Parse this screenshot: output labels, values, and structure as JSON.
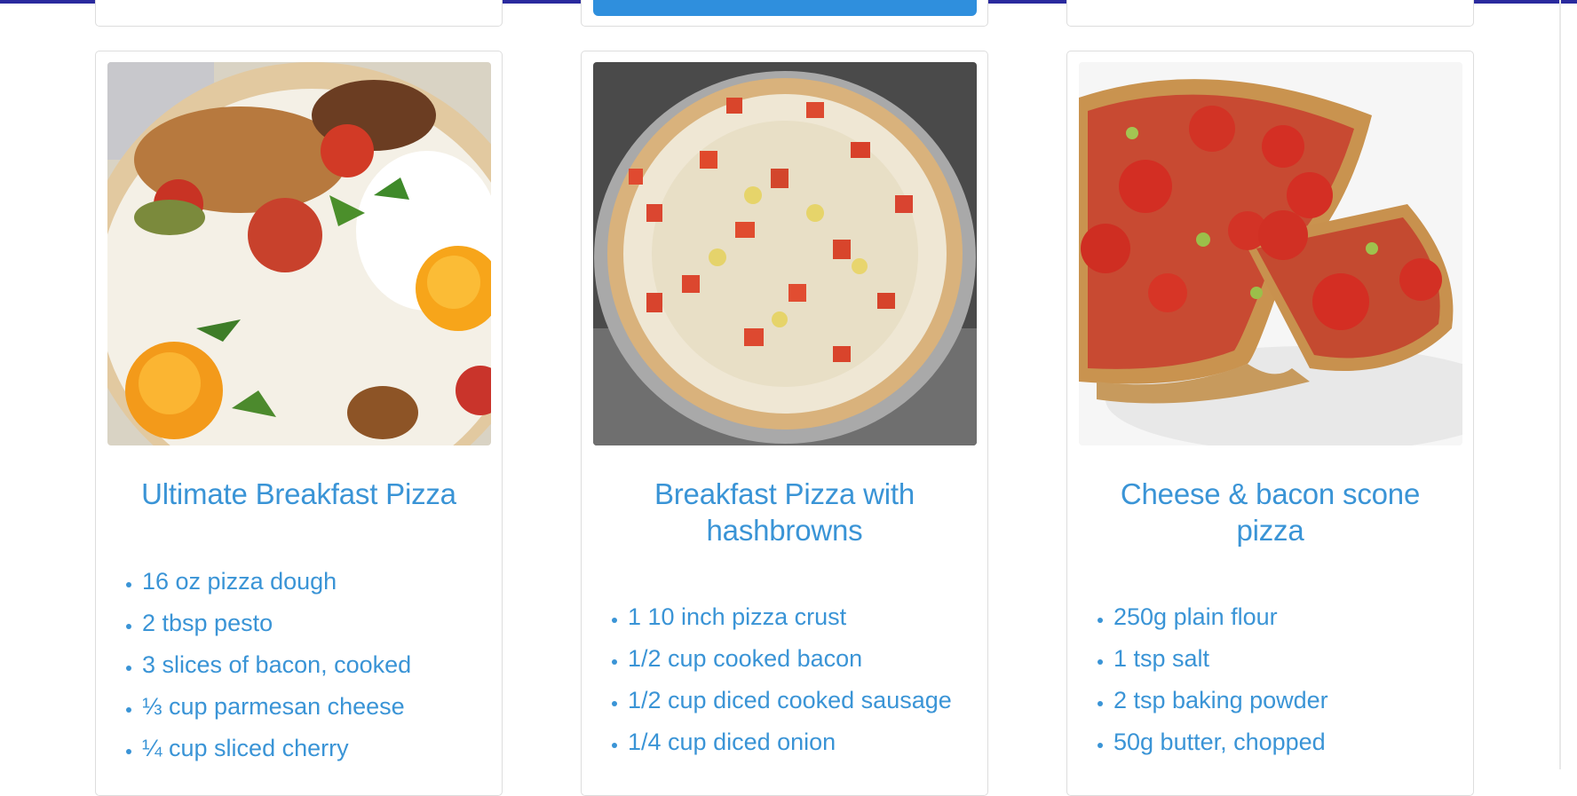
{
  "recipes": [
    {
      "title": "Ultimate Breakfast Pizza",
      "ingredients": [
        "16 oz pizza dough",
        "2 tbsp pesto",
        "3 slices of bacon, cooked",
        "⅓ cup parmesan cheese",
        "¼ cup sliced cherry"
      ]
    },
    {
      "title": "Breakfast Pizza with hashbrowns",
      "ingredients": [
        "1 10 inch pizza crust",
        "1/2 cup cooked bacon",
        "1/2 cup diced cooked sausage",
        "1/4 cup diced onion"
      ]
    },
    {
      "title": "Cheese & bacon scone pizza",
      "ingredients": [
        "250g plain flour",
        "1 tsp salt",
        "2 tsp baking powder",
        "50g butter, chopped"
      ]
    }
  ],
  "colors": {
    "accent": "#3a94d6",
    "topbar": "#2a2a9e",
    "button": "#2f8fdd",
    "border": "#dddddd"
  }
}
